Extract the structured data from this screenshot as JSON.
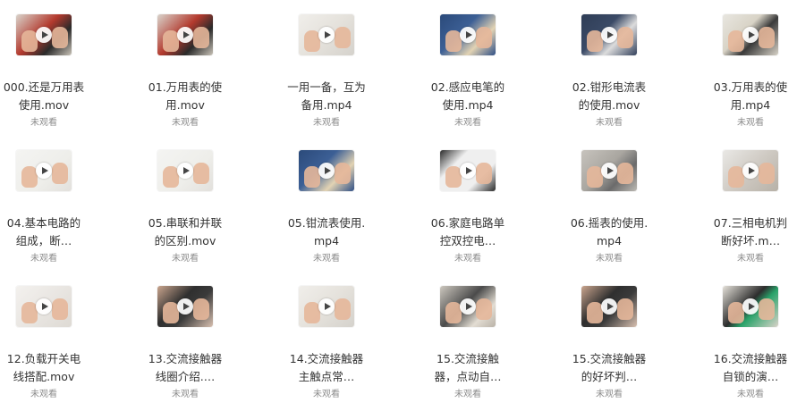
{
  "status_label": "未观看",
  "items": [
    {
      "title": "000.还是万用表使用.mov",
      "thumb": "meter-red"
    },
    {
      "title": "01.万用表的使用.mov",
      "thumb": "meter-red"
    },
    {
      "title": "一用一备，互为备用.mp4",
      "thumb": "paper"
    },
    {
      "title": "02.感应电笔的使用.mp4",
      "thumb": "blue-panel"
    },
    {
      "title": "02.钳形电流表的使用.mov",
      "thumb": "clamp"
    },
    {
      "title": "03.万用表的使用.mp4",
      "thumb": "meter-green"
    },
    {
      "title": "04.基本电路的组成，断…",
      "thumb": "whiteboard"
    },
    {
      "title": "05.串联和并联的区别.mov",
      "thumb": "whiteboard"
    },
    {
      "title": "05.钳流表使用.mp4",
      "thumb": "blue-panel"
    },
    {
      "title": "06.家庭电路单控双控电…",
      "thumb": "dark-board"
    },
    {
      "title": "06.摇表的使用.mp4",
      "thumb": "meter-grey"
    },
    {
      "title": "07.三相电机判断好坏.m…",
      "thumb": "motor"
    },
    {
      "title": "12.负载开关电线搭配.mov",
      "thumb": "hands"
    },
    {
      "title": "13.交流接触器线圈介绍.…",
      "thumb": "contactor"
    },
    {
      "title": "14.交流接触器主触点常…",
      "thumb": "paper"
    },
    {
      "title": "15.交流接触器，点动自…",
      "thumb": "panel"
    },
    {
      "title": "15.交流接触器的好坏判…",
      "thumb": "contactor"
    },
    {
      "title": "16.交流接触器自锁的演…",
      "thumb": "green-button"
    }
  ]
}
